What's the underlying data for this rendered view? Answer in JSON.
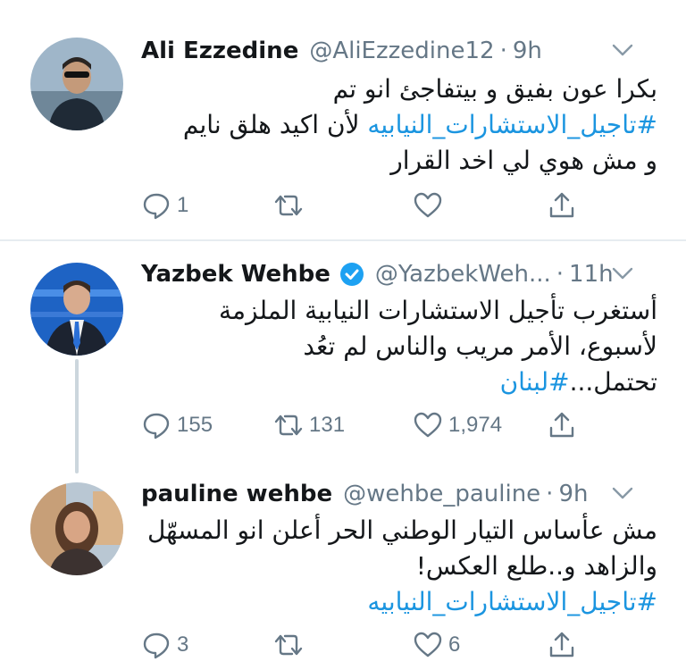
{
  "colors": {
    "link": "#1b95e0",
    "meta": "#657786",
    "text": "#14171a",
    "verified": "#1da1f2"
  },
  "tweets": [
    {
      "name": "Ali Ezzedine",
      "handle": "@AliEzzedine12",
      "dot": "·",
      "time": "9h",
      "lines": [
        "بكرا عون بفيق و بيتفاجئ انو تم",
        "#تاجيل_الاستشارات_النيابيه",
        "لأن اكيد هلق نايم",
        "و مش هوي لي اخد القرار"
      ],
      "actions": {
        "reply": "1",
        "retweet": "",
        "like": "",
        "share_icon": "share-icon"
      }
    },
    {
      "name": "Yazbek Wehbe",
      "handle": "@YazbekWeh...",
      "dot": "·",
      "time": "11h",
      "verified": true,
      "lines": [
        "أستغرب تأجيل الاستشارات النيابية الملزمة",
        "لأسبوع،  الأمر مريب والناس لم تعُد",
        "تحتمل...",
        "#لبنان"
      ],
      "actions": {
        "reply": "155",
        "retweet": "131",
        "like": "1,974"
      }
    },
    {
      "name": "pauline wehbe",
      "handle": "@wehbe_pauline",
      "dot": "·",
      "time": "9h",
      "lines": [
        "مش عأساس التيار الوطني الحر أعلن انو المسهّل",
        "والزاهد و..طلع العكس!",
        "#تاجيل_الاستشارات_النيابيه"
      ],
      "actions": {
        "reply": "3",
        "retweet": "",
        "like": "6"
      }
    }
  ]
}
